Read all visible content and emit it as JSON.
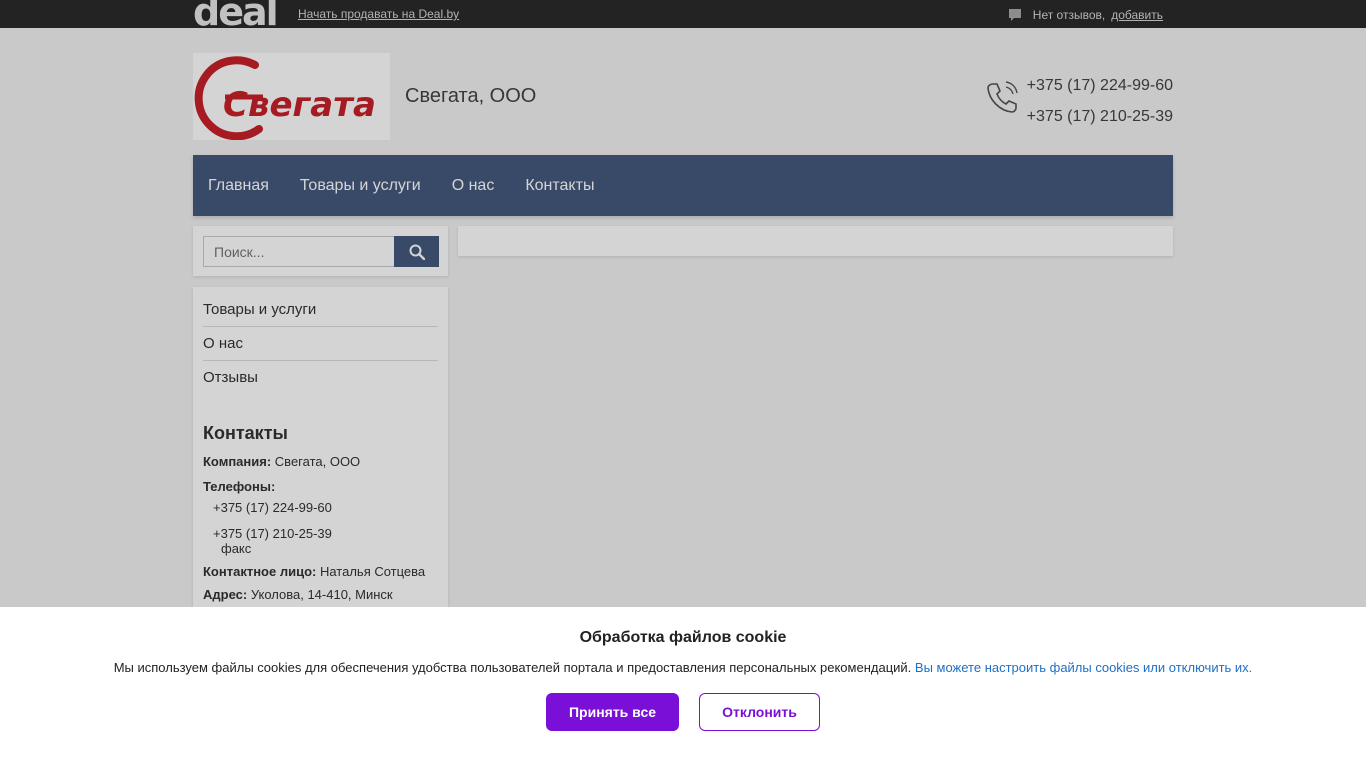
{
  "topbar": {
    "logo_text": "deal",
    "sell_link": "Начать продавать на Deal.by",
    "reviews_text": "Нет отзывов,",
    "reviews_add": "добавить"
  },
  "header": {
    "logo_text": "Свегата",
    "company_name": "Свегата, ООО",
    "phones": [
      "+375 (17) 224-99-60",
      "+375 (17) 210-25-39"
    ]
  },
  "nav": {
    "items": [
      "Главная",
      "Товары и услуги",
      "О нас",
      "Контакты"
    ]
  },
  "search": {
    "placeholder": "Поиск..."
  },
  "sidebar": {
    "menu": [
      "Товары и услуги",
      "О нас",
      "Отзывы"
    ],
    "contacts_title": "Контакты",
    "company_label": "Компания:",
    "company_value": "Свегата, ООО",
    "phones_label": "Телефоны:",
    "phone1": "+375 (17) 224-99-60",
    "phone2": "+375 (17) 210-25-39",
    "phone2_note": "факс",
    "person_label": "Контактное лицо:",
    "person_value": "Наталья Сотцева",
    "address_label": "Адрес:",
    "address_value": "Уколова, 14-410, Минск"
  },
  "cookie": {
    "title": "Обработка файлов cookie",
    "text": "Мы используем файлы cookies для обеспечения удобства пользователей портала и предоставления персональных рекомендаций.",
    "link": "Вы можете настроить файлы cookies или отключить их.",
    "accept": "Принять все",
    "decline": "Отклонить"
  },
  "colors": {
    "nav_bg": "#44597d",
    "accent_purple": "#7a0fd8",
    "logo_red": "#c8202a"
  }
}
